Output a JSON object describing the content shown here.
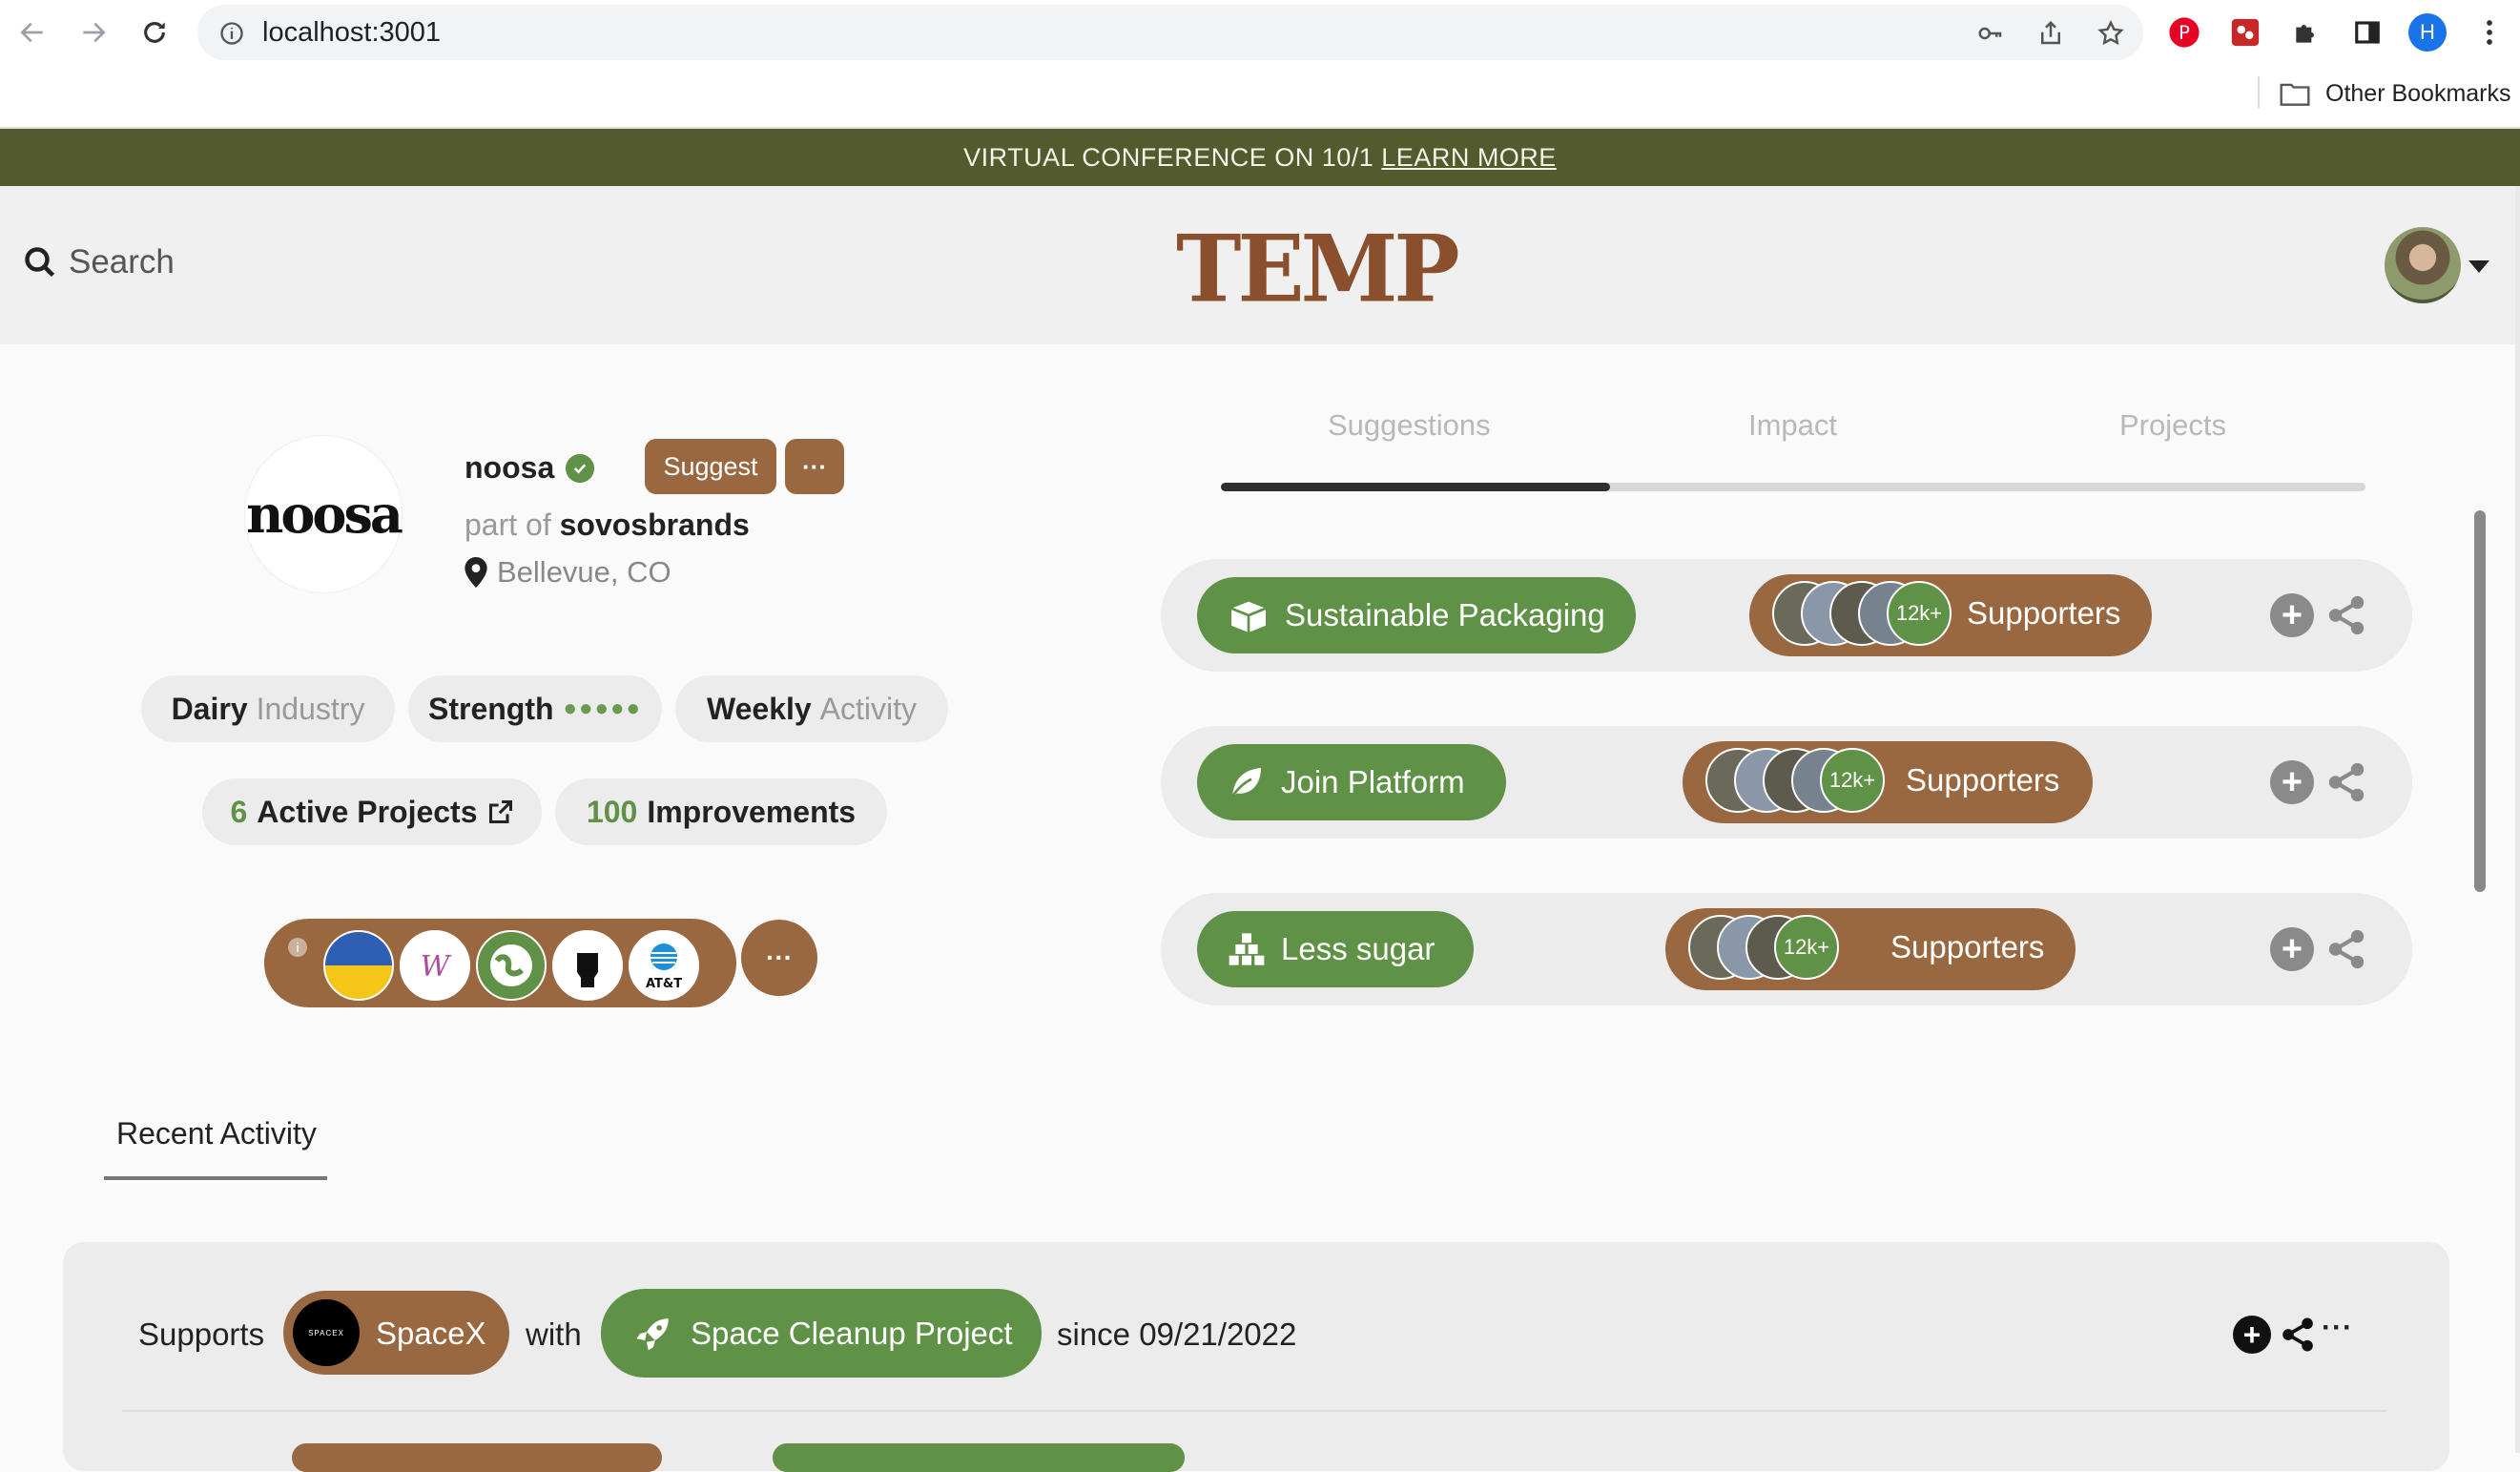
{
  "browser": {
    "url": "localhost:3001",
    "profile_initial": "H",
    "other_bookmarks": "Other Bookmarks"
  },
  "banner": {
    "text": "VIRTUAL CONFERENCE ON 10/1",
    "link": "LEARN MORE",
    "color": "#535a2e"
  },
  "header": {
    "search_label": "Search",
    "logo": "TEMP"
  },
  "profile": {
    "logo_text": "noosa",
    "name": "noosa",
    "suggest_label": "Suggest",
    "more_label": "···",
    "part_of_prefix": "part of",
    "parent": "sovosbrands",
    "location": "Bellevue, CO",
    "pills": {
      "industry_bold": "Dairy",
      "industry_muted": "Industry",
      "strength": "Strength",
      "strength_dots": "●●●●●",
      "activity_bold": "Weekly",
      "activity_muted": "Activity",
      "projects_count": "6",
      "projects_label": "Active Projects",
      "improvements_count": "100",
      "improvements_label": "Improvements"
    },
    "causes": [
      "ukraine-flag",
      "women-org",
      "earth-org",
      "fist-org",
      "att"
    ],
    "causes_att_label": "AT&T",
    "causes_more": "···"
  },
  "tabs": {
    "items": [
      "Suggestions",
      "Impact",
      "Projects"
    ],
    "active": "Suggestions"
  },
  "suggestions": [
    {
      "label": "Sustainable Packaging",
      "icon": "box-icon",
      "supporters_badge": "12k+",
      "supporters_label": "Supporters"
    },
    {
      "label": "Join Platform",
      "icon": "leaf-icon",
      "supporters_badge": "12k+",
      "supporters_label": "Supporters"
    },
    {
      "label": "Less sugar",
      "icon": "cubes-icon",
      "supporters_badge": "12k+",
      "supporters_label": "Supporters"
    }
  ],
  "recent_activity": {
    "tab_label": "Recent Activity",
    "items": [
      {
        "prefix": "Supports",
        "company": "SpaceX",
        "company_logo_text": "SPACEX",
        "connector": "with",
        "project": "Space Cleanup Project",
        "since": "since 09/21/2022",
        "more": "···"
      }
    ]
  },
  "colors": {
    "brown": "#9a6840",
    "green": "#5f9146",
    "olive": "#535a2e",
    "logo": "#8a4f2c"
  }
}
